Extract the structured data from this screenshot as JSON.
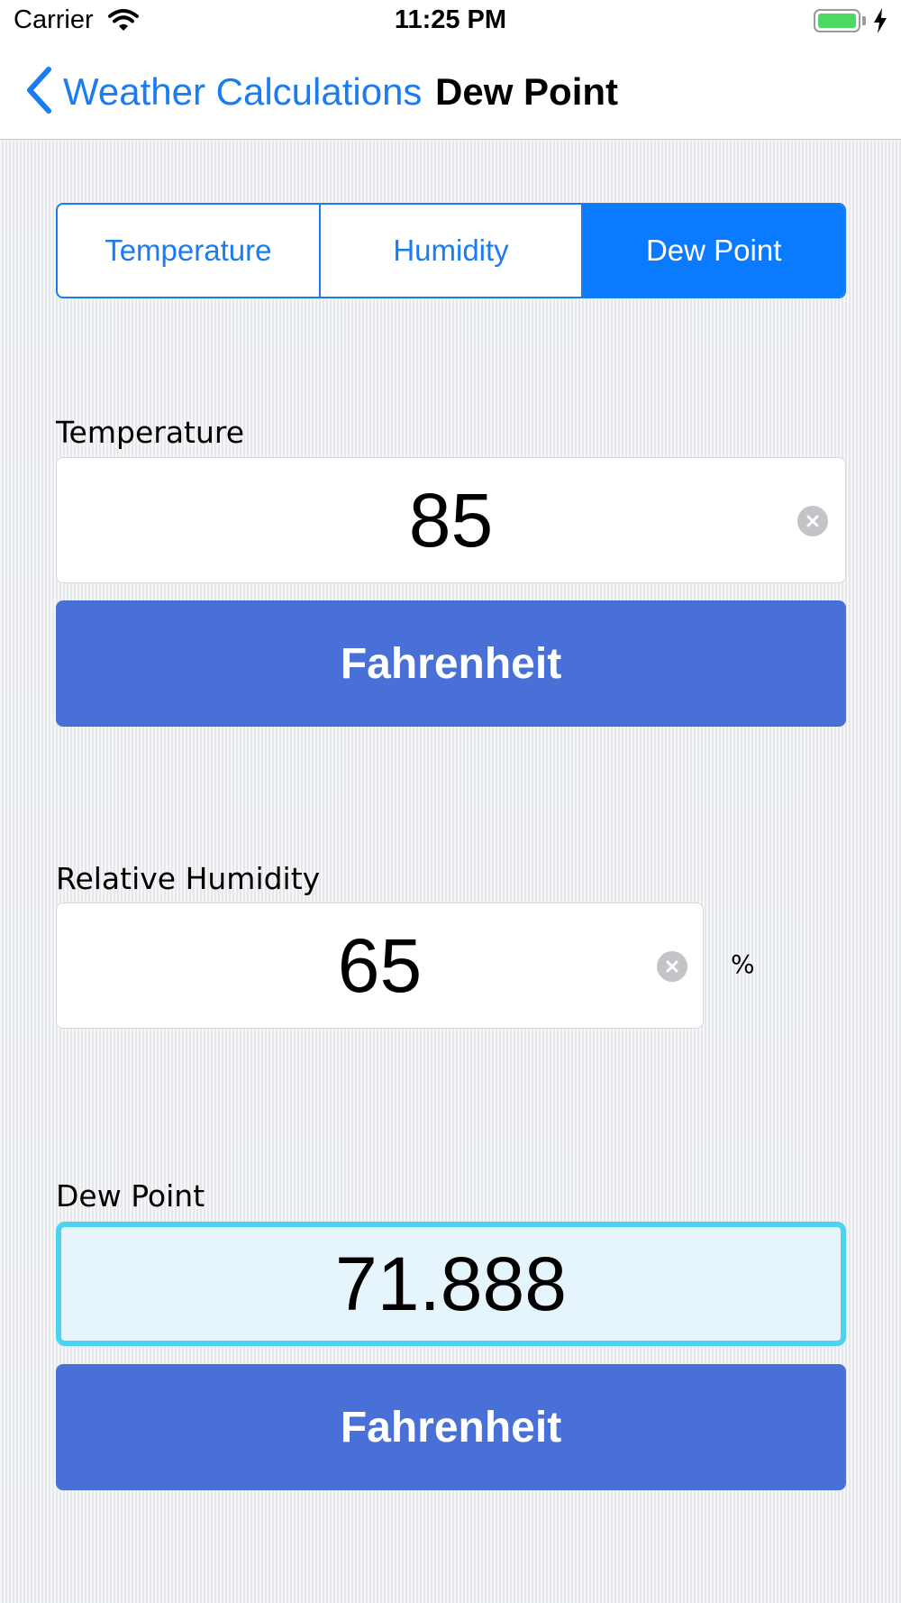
{
  "status_bar": {
    "carrier": "Carrier",
    "time": "11:25 PM"
  },
  "nav": {
    "back_label": "Weather Calculations",
    "title": "Dew Point"
  },
  "tabs": [
    {
      "label": "Temperature",
      "selected": false
    },
    {
      "label": "Humidity",
      "selected": false
    },
    {
      "label": "Dew Point",
      "selected": true
    }
  ],
  "temperature": {
    "label": "Temperature",
    "value": "85",
    "unit_button": "Fahrenheit"
  },
  "humidity": {
    "label": "Relative Humidity",
    "value": "65",
    "unit": "%"
  },
  "dew_point": {
    "label": "Dew Point",
    "value": "71.888",
    "unit_button": "Fahrenheit"
  },
  "colors": {
    "accent": "#1a7cf0",
    "segment_active": "#0a7bff",
    "unit_button": "#4870d6",
    "result_border": "#4dd3f2",
    "result_bg": "#e6f4fb"
  }
}
